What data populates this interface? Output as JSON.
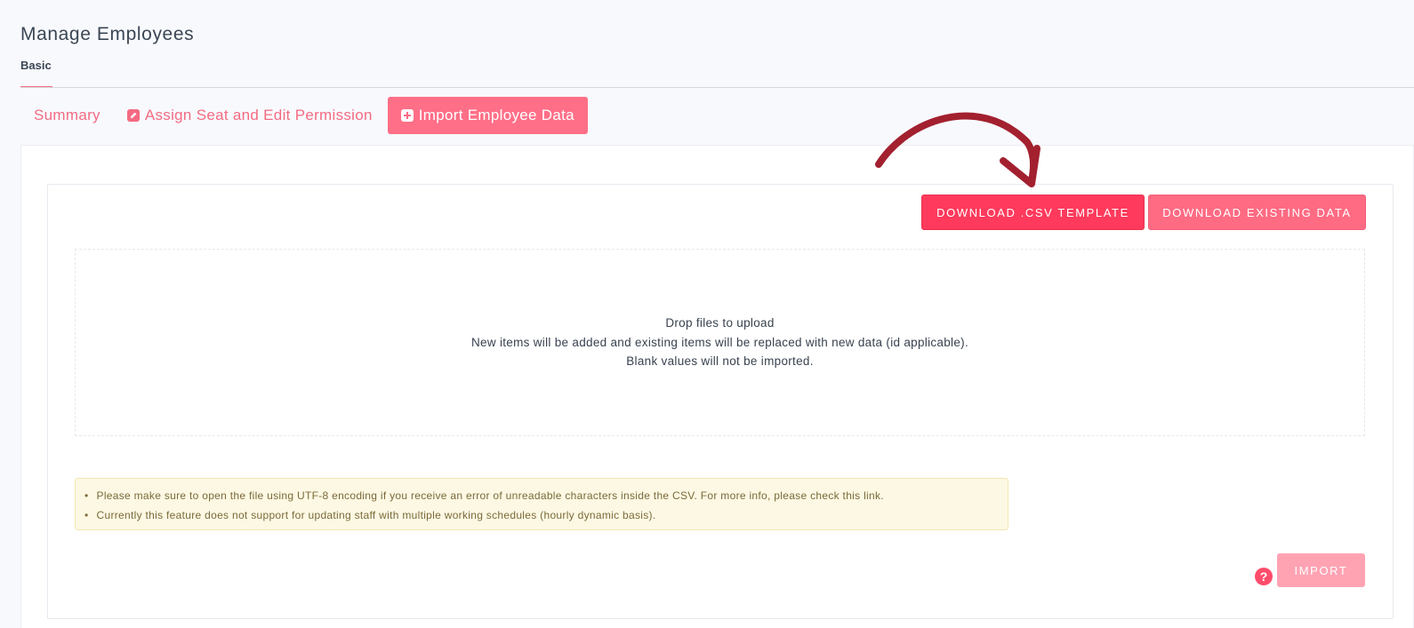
{
  "page": {
    "title": "Manage Employees",
    "subtab": "Basic"
  },
  "tabs": [
    {
      "label": "Summary",
      "icon": ""
    },
    {
      "label": "Assign Seat and Edit Permission",
      "icon": "edit-icon"
    },
    {
      "label": "Import Employee Data",
      "icon": "plus-square-icon",
      "active": true
    }
  ],
  "actions": {
    "download_csv_label": "DOWNLOAD .CSV TEMPLATE",
    "download_existing_label": "DOWNLOAD EXISTING DATA",
    "import_label": "IMPORT"
  },
  "dropzone": {
    "line1": "Drop files to upload",
    "line2": "New items will be added and existing items will be replaced with new data (id applicable).",
    "line3": "Blank values will not be imported."
  },
  "notices": [
    "Please make sure to open the file using UTF-8 encoding if you receive an error of unreadable characters inside the CSV. For more info, please check this link.",
    "Currently this feature does not support for updating staff with multiple working schedules (hourly dynamic basis)."
  ],
  "help_icon": "question-circle-icon",
  "colors": {
    "accent": "#ff6f87",
    "primary_button": "#ff3a5c",
    "annotation_arrow": "#a3202f"
  }
}
